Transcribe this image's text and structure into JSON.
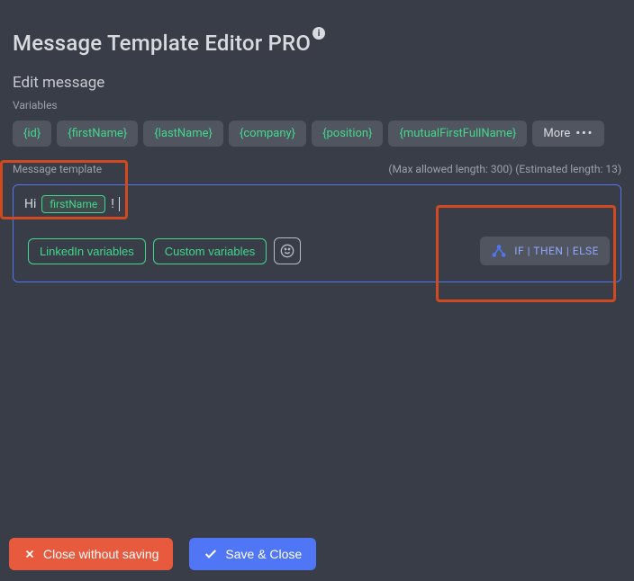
{
  "header": {
    "title": "Message Template Editor PRO"
  },
  "edit": {
    "title": "Edit message",
    "variables_label": "Variables",
    "chips": [
      "{id}",
      "{firstName}",
      "{lastName}",
      "{company}",
      "{position}",
      "{mutualFirstFullName}"
    ],
    "more_label": "More"
  },
  "template": {
    "label": "Message template",
    "limits": "(Max allowed length: 300) (Estimated length: 13)",
    "text_prefix": "Hi",
    "variable": "firstName",
    "text_suffix": "!",
    "linkedin_btn": "LinkedIn variables",
    "custom_btn": "Custom variables",
    "ifelse_label": "IF | THEN | ELSE"
  },
  "footer": {
    "close_label": "Close without saving",
    "save_label": "Save & Close"
  }
}
